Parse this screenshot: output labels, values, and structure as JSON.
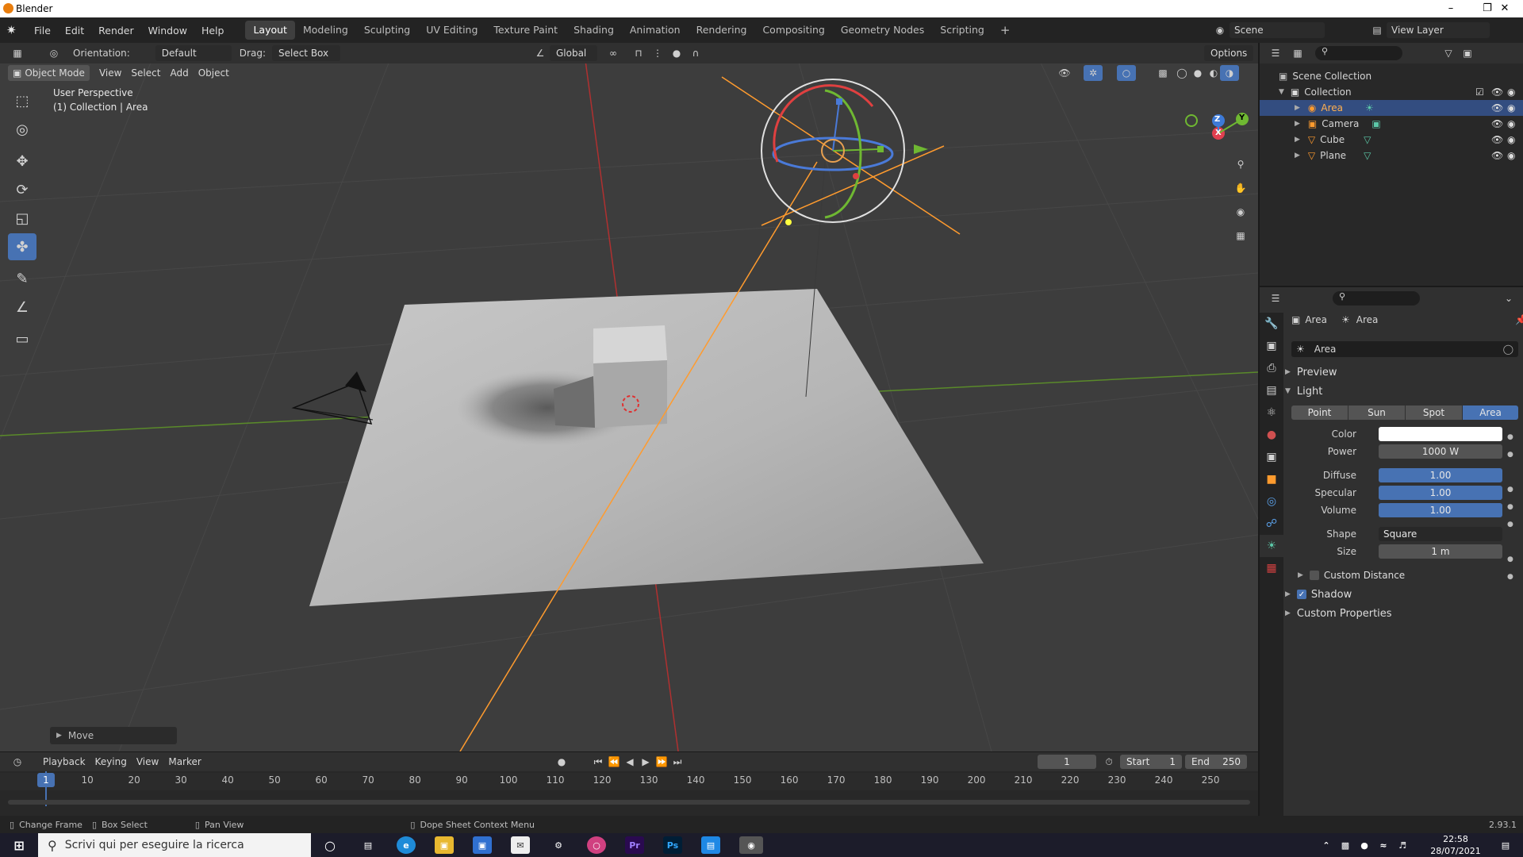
{
  "window": {
    "title": "Blender"
  },
  "menu": {
    "items": [
      "File",
      "Edit",
      "Render",
      "Window",
      "Help"
    ]
  },
  "workspaces": [
    "Layout",
    "Modeling",
    "Sculpting",
    "UV Editing",
    "Texture Paint",
    "Shading",
    "Animation",
    "Rendering",
    "Compositing",
    "Geometry Nodes",
    "Scripting"
  ],
  "scene": {
    "name": "Scene",
    "view_layer": "View Layer"
  },
  "viewport_header": {
    "orientation_label": "Orientation:",
    "orientation_value": "Default",
    "drag_label": "Drag:",
    "drag_value": "Select Box",
    "transform_orientation": "Global",
    "options": "Options"
  },
  "viewport_header2": {
    "mode": "Object Mode",
    "items": [
      "View",
      "Select",
      "Add",
      "Object"
    ]
  },
  "viewport": {
    "perspective": "User Perspective",
    "collection_info": "(1) Collection | Area",
    "last_op": "Move",
    "gizmo_axes": {
      "z": "Z",
      "y": "Y",
      "x": "X"
    }
  },
  "outliner": {
    "root": "Scene Collection",
    "collection": "Collection",
    "objects": [
      {
        "name": "Area",
        "selected": true
      },
      {
        "name": "Camera",
        "selected": false
      },
      {
        "name": "Cube",
        "selected": false
      },
      {
        "name": "Plane",
        "selected": false
      }
    ]
  },
  "properties": {
    "breadcrumb": [
      "Area",
      "Area"
    ],
    "data_name": "Area",
    "panels": {
      "preview": "Preview",
      "light": "Light",
      "custom_distance": "Custom Distance",
      "shadow": "Shadow",
      "custom_properties": "Custom Properties"
    },
    "light_types": [
      "Point",
      "Sun",
      "Spot",
      "Area"
    ],
    "active_light_type": "Area",
    "fields": {
      "color_label": "Color",
      "power_label": "Power",
      "power_value": "1000 W",
      "diffuse_label": "Diffuse",
      "diffuse_value": "1.00",
      "specular_label": "Specular",
      "specular_value": "1.00",
      "volume_label": "Volume",
      "volume_value": "1.00",
      "shape_label": "Shape",
      "shape_value": "Square",
      "size_label": "Size",
      "size_value": "1 m"
    },
    "shadow_checked": true,
    "custom_distance_checked": false
  },
  "timeline": {
    "menus": [
      "Playback",
      "Keying",
      "View",
      "Marker"
    ],
    "current_frame": "1",
    "start_label": "Start",
    "start_value": "1",
    "end_label": "End",
    "end_value": "250",
    "ruler_ticks": [
      "1",
      "10",
      "20",
      "30",
      "40",
      "50",
      "60",
      "70",
      "80",
      "90",
      "100",
      "110",
      "120",
      "130",
      "140",
      "150",
      "160",
      "170",
      "180",
      "190",
      "200",
      "210",
      "220",
      "230",
      "240",
      "250"
    ]
  },
  "statusbar": {
    "items": [
      "Change Frame",
      "Box Select",
      "Pan View",
      "Dope Sheet Context Menu"
    ],
    "version": "2.93.1"
  },
  "taskbar": {
    "search_placeholder": "Scrivi qui per eseguire la ricerca",
    "time": "22:58",
    "date": "28/07/2021"
  },
  "colors": {
    "accent": "#4772b3",
    "selected_row": "#334d80",
    "light_orange": "#ff9b2e",
    "grid_red": "#b03030",
    "grid_green": "#5a8a2a"
  }
}
